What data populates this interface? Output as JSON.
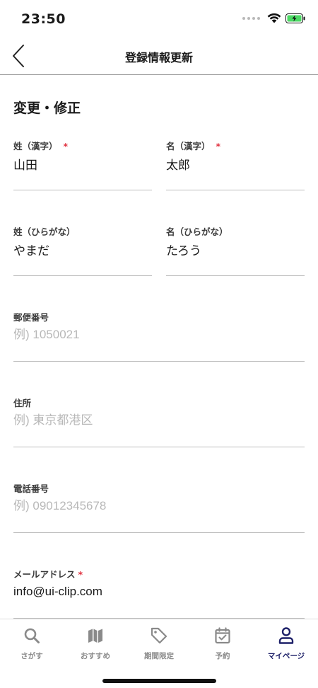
{
  "status_bar": {
    "time": "23:50"
  },
  "header": {
    "title": "登録情報更新"
  },
  "section": {
    "title": "変更・修正"
  },
  "required_mark": "*",
  "form": {
    "last_name_kanji": {
      "label": "姓（漢字）",
      "value": "山田"
    },
    "first_name_kanji": {
      "label": "名（漢字）",
      "value": "太郎"
    },
    "last_name_kana": {
      "label": "姓（ひらがな）",
      "value": "やまだ"
    },
    "first_name_kana": {
      "label": "名（ひらがな）",
      "value": "たろう"
    },
    "postal_code": {
      "label": "郵便番号",
      "placeholder": "例) 1050021"
    },
    "address": {
      "label": "住所",
      "placeholder": "例) 東京都港区"
    },
    "phone": {
      "label": "電話番号",
      "placeholder": "例) 09012345678"
    },
    "email": {
      "label": "メールアドレス",
      "value": "info@ui-clip.com"
    }
  },
  "tabs": [
    {
      "label": "さがす",
      "icon": "search-icon"
    },
    {
      "label": "おすすめ",
      "icon": "map-icon"
    },
    {
      "label": "期間限定",
      "icon": "tag-icon"
    },
    {
      "label": "予約",
      "icon": "calendar-check-icon"
    },
    {
      "label": "マイページ",
      "icon": "person-icon",
      "active": true
    }
  ],
  "colors": {
    "accent": "#1e2169",
    "required": "#e0313f",
    "inactive_tab": "#8a8a8a",
    "battery": "#4cd964"
  }
}
